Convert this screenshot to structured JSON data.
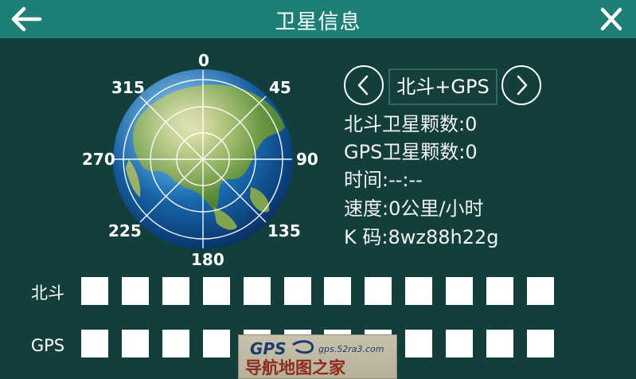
{
  "header": {
    "title": "卫星信息",
    "back_icon": "arrow-left-icon",
    "close_icon": "close-icon"
  },
  "compass": {
    "labels": [
      "0",
      "45",
      "90",
      "135",
      "180",
      "225",
      "270",
      "315"
    ]
  },
  "system_selector": {
    "prev_icon": "chevron-left-icon",
    "next_icon": "chevron-right-icon",
    "current": "北斗+GPS"
  },
  "info": {
    "beidou_count_label": "北斗卫星颗数:",
    "beidou_count_value": "0",
    "gps_count_label": "GPS卫星颗数:",
    "gps_count_value": "0",
    "time_label": "时间:",
    "time_value": "--:--",
    "speed_label": "速度:",
    "speed_value": "0公里/小时",
    "kcode_label": "K 码:",
    "kcode_value": "8wz88h22g"
  },
  "signal_rows": {
    "beidou_label": "北斗",
    "gps_label": "GPS",
    "slots_per_row": 12
  },
  "watermark": {
    "logo_text": "GPS",
    "site": "gps.52ra3.com",
    "slogan": "导航地图之家"
  },
  "colors": {
    "background": "#123f3c",
    "header": "#1e7f77",
    "text": "#ffffff"
  }
}
